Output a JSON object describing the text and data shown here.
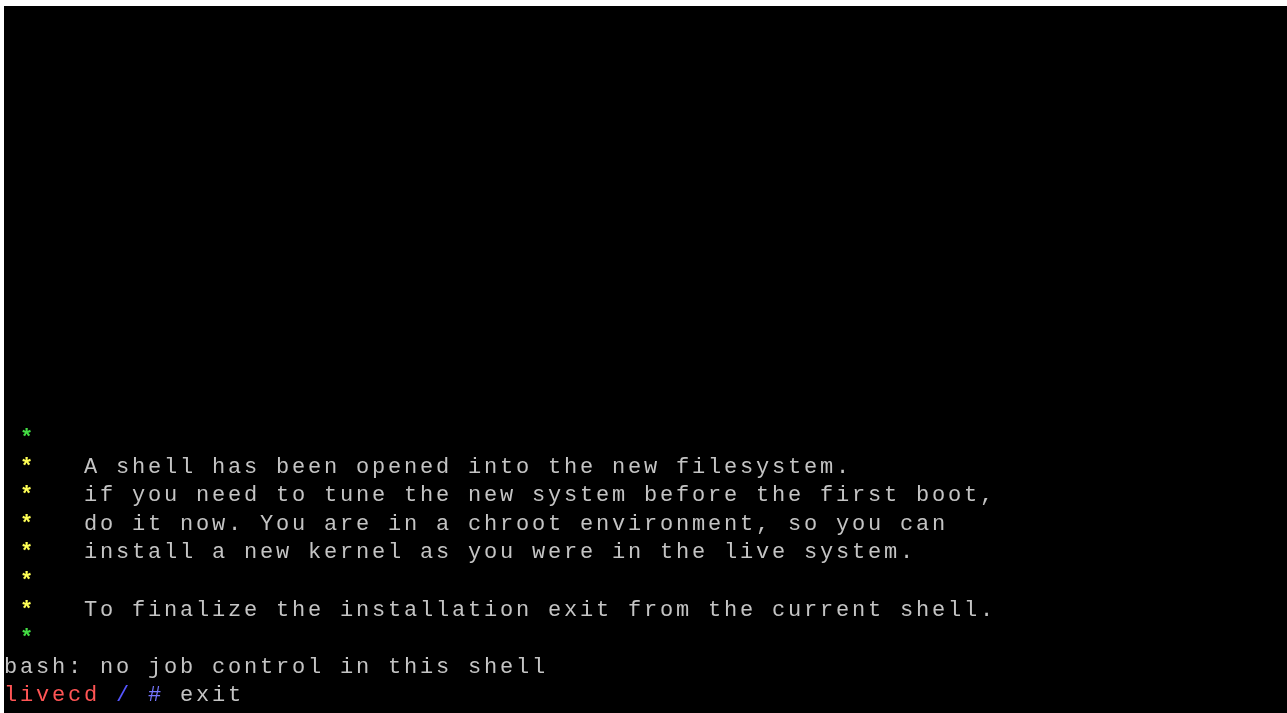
{
  "console": {
    "banner": [
      {
        "bullet": "*",
        "color": "#44dd44"
      },
      {
        "bullet": "*",
        "color": "#ffff55",
        "text": "A shell has been opened into the new filesystem."
      },
      {
        "bullet": "*",
        "color": "#ffff55",
        "text": "if you need to tune the new system before the first boot,"
      },
      {
        "bullet": "*",
        "color": "#ffff55",
        "text": "do it now. You are in a chroot environment, so you can"
      },
      {
        "bullet": "*",
        "color": "#ffff55",
        "text": "install a new kernel as you were in the live system."
      },
      {
        "bullet": "*",
        "color": "#ffff55"
      },
      {
        "bullet": "*",
        "color": "#ffff55",
        "text": "To finalize the installation exit from the current shell."
      },
      {
        "bullet": "*",
        "color": "#44dd44"
      }
    ],
    "message": "bash: no job control in this shell",
    "prompt": {
      "host": "livecd",
      "path": "/",
      "symbol": "#",
      "command": "exit"
    }
  }
}
